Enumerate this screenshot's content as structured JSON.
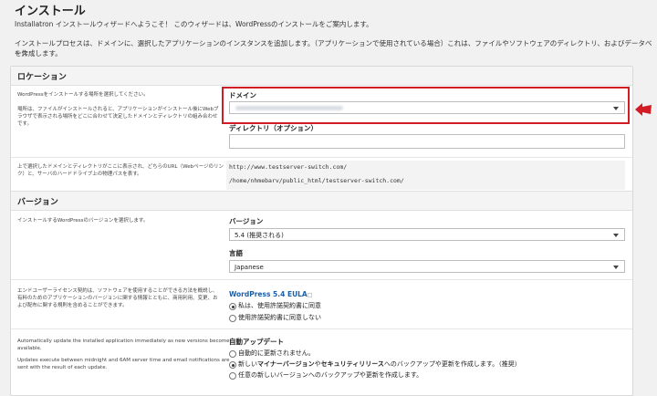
{
  "page": {
    "title": "インストール",
    "intro_line1": "Installatron インストールウィザードへようこそ！ このウィザードは、WordPressのインストールをご案内します。",
    "intro_line2": "インストールプロセスは、ドメインに、選択したアプリケーションのインスタンスを追加します。（アプリケーションで使用されている場合）これは、ファイルやソフトウェアのディレクトリ、およびデータベース",
    "intro_line3": "を作成します。"
  },
  "location": {
    "header": "ロケーション",
    "desc1": "WordPressをインストールする場所を選択してください。",
    "desc2_l1": "場所は、ファイルがインストールされると、アプリケーションがインストール後にWebブ",
    "desc2_l2": "ラウザで表示される場所をどこに合わせて決定したドメインとディレクトリの組み合わせ",
    "desc2_l3": "です。",
    "domain_label": "ドメイン",
    "directory_label": "ディレクトリ（オプション）",
    "directory_value": "",
    "path_desc_l1": "上で選択したドメインとディレクトリがここに表示され、どちらのURL（Webページのリン",
    "path_desc_l2": "ク）と、サーバのハードドライブ上の物理パスを表す。",
    "url_preview": "http://www.testserver-switch.com/",
    "path_preview": "/home/nhmebarv/public_html/testserver-switch.com/"
  },
  "version": {
    "header": "バージョン",
    "desc": "インストールするWordPressのバージョンを選択します。",
    "version_label": "バージョン",
    "version_value": "5.4 (推奨される)",
    "language_label": "言語",
    "language_value": "Japanese",
    "eula_desc_l1": "エンドユーザーライセンス契約は、ソフトウェアを使用することができる方法を概説し、",
    "eula_desc_l2": "有料のためのアプリケーションのバージョンに関する情報とともに、商用利用、変更、お",
    "eula_desc_l3": "よび配布に関する規則を含めることができます。",
    "eula_title": "WordPress 5.4 EULA",
    "eula_mark": "□",
    "eula_agree": "私は、使用許諾契約書に同意",
    "eula_disagree": "使用許諾契約書に同意しない"
  },
  "autoupdate": {
    "desc_l1": "Automatically update the installed application immediately as new versions become",
    "desc_l2": "available.",
    "desc2_l1": "Updates execute between midnight and 6AM server time and email notifications are",
    "desc2_l2": "sent with the result of each update.",
    "label": "自動アップデート",
    "opt1": "自動的に更新されません。",
    "opt2_pre": "新しい",
    "opt2_bold1": "マイナーバージョン",
    "opt2_mid": "や",
    "opt2_bold2": "セキュリティリリース",
    "opt2_post": "へのバックアップや更新を作成します。（推奨）",
    "opt3": "任意の新しいバージョンへのバックアップや更新を作成します。"
  },
  "colors": {
    "highlight": "#d31d26",
    "eula_link": "#1a5fa8"
  }
}
